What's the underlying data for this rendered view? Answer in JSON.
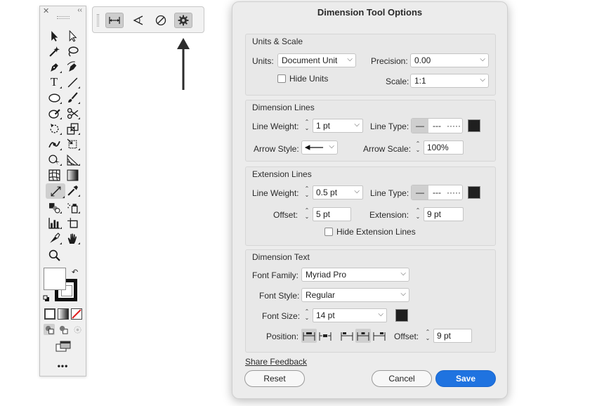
{
  "dialog": {
    "title": "Dimension Tool Options",
    "units_scale": {
      "title": "Units & Scale",
      "units_label": "Units:",
      "units_value": "Document Unit",
      "precision_label": "Precision:",
      "precision_value": "0.00",
      "hide_units_label": "Hide Units",
      "scale_label": "Scale:",
      "scale_value": "1:1"
    },
    "dimension_lines": {
      "title": "Dimension Lines",
      "line_weight_label": "Line Weight:",
      "line_weight_value": "1 pt",
      "line_type_label": "Line Type:",
      "arrow_style_label": "Arrow Style:",
      "arrow_scale_label": "Arrow Scale:",
      "arrow_scale_value": "100%",
      "color": "#1f1f1f"
    },
    "extension_lines": {
      "title": "Extension Lines",
      "line_weight_label": "Line Weight:",
      "line_weight_value": "0.5 pt",
      "line_type_label": "Line Type:",
      "offset_label": "Offset:",
      "offset_value": "5 pt",
      "extension_label": "Extension:",
      "extension_value": "9 pt",
      "hide_label": "Hide Extension Lines",
      "color": "#1f1f1f"
    },
    "dimension_text": {
      "title": "Dimension Text",
      "font_family_label": "Font Family:",
      "font_family_value": "Myriad Pro",
      "font_style_label": "Font Style:",
      "font_style_value": "Regular",
      "font_size_label": "Font Size:",
      "font_size_value": "14 pt",
      "position_label": "Position:",
      "offset_label": "Offset:",
      "offset_value": "9 pt",
      "color": "#1f1f1f"
    },
    "share_feedback": "Share Feedback",
    "reset_label": "Reset",
    "cancel_label": "Cancel",
    "save_label": "Save",
    "primary_color": "#1f73e0"
  },
  "tools_panel": {
    "more_label": "•••"
  },
  "control_bar": {
    "buttons": [
      "dimension-linear-icon",
      "dimension-angular-icon",
      "dimension-radial-icon",
      "gear-icon"
    ],
    "active": "gear-icon"
  }
}
